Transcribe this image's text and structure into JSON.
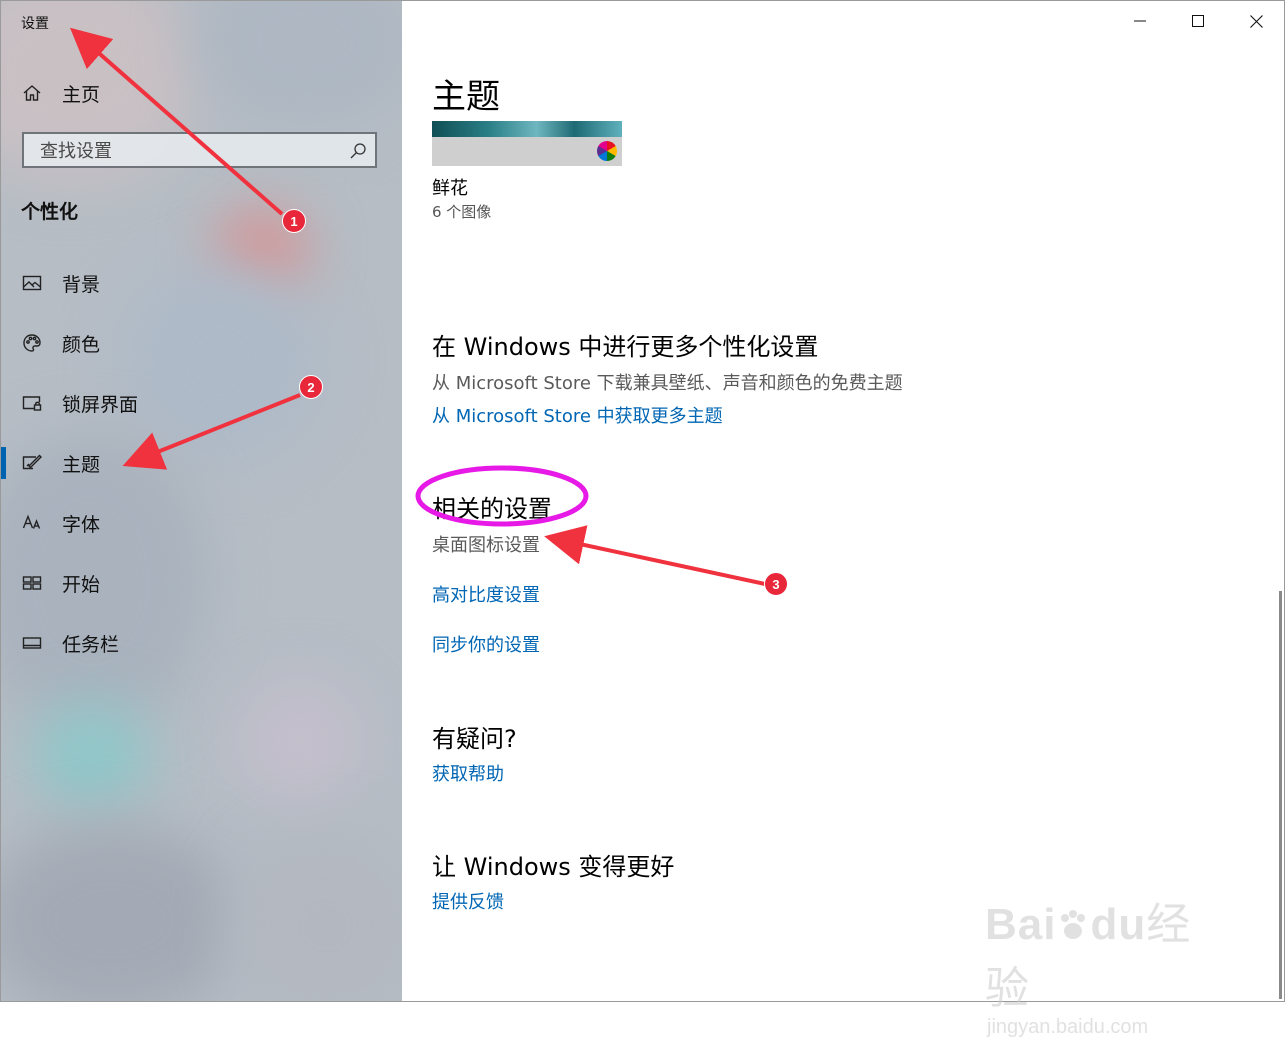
{
  "window": {
    "title": "设置"
  },
  "sidebar": {
    "home_label": "主页",
    "search_placeholder": "查找设置",
    "section_heading": "个性化",
    "items": [
      {
        "label": "背景",
        "icon": "picture-icon"
      },
      {
        "label": "颜色",
        "icon": "palette-icon"
      },
      {
        "label": "锁屏界面",
        "icon": "lock-screen-icon"
      },
      {
        "label": "主题",
        "icon": "theme-brush-icon",
        "active": true
      },
      {
        "label": "字体",
        "icon": "font-icon"
      },
      {
        "label": "开始",
        "icon": "start-grid-icon"
      },
      {
        "label": "任务栏",
        "icon": "taskbar-icon"
      }
    ]
  },
  "main": {
    "page_title": "主题",
    "current_theme": {
      "name": "鲜花",
      "count": "6 个图像"
    },
    "more_section": {
      "heading": "在 Windows 中进行更多个性化设置",
      "description": "从 Microsoft Store 下载兼具壁纸、声音和颜色的免费主题",
      "link": "从 Microsoft Store 中获取更多主题"
    },
    "related_section": {
      "heading": "相关的设置",
      "desktop_icon_settings": "桌面图标设置",
      "high_contrast_link": "高对比度设置",
      "sync_link": "同步你的设置"
    },
    "question_section": {
      "heading": "有疑问?",
      "link": "获取帮助"
    },
    "feedback_section": {
      "heading": "让 Windows 变得更好",
      "link": "提供反馈"
    }
  },
  "annotations": {
    "badges": [
      "1",
      "2",
      "3"
    ],
    "arrow_color": "#f0323e",
    "ellipse_color": "#e619e6"
  },
  "colors": {
    "accent": "#0063b1",
    "link": "#0066b4"
  },
  "watermark": {
    "logo_left": "Bai",
    "logo_right": "du",
    "cn": "经验",
    "url": "jingyan.baidu.com"
  }
}
